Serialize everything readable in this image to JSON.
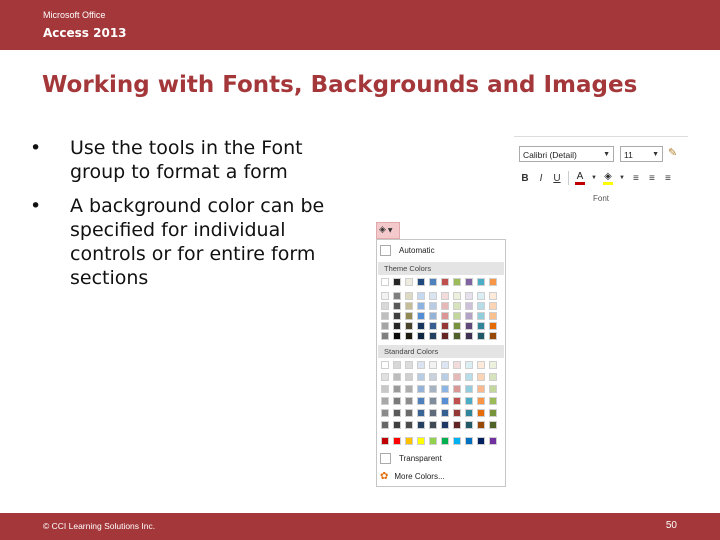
{
  "header": {
    "brand": "Microsoft Office",
    "product": "Access 2013"
  },
  "slide": {
    "title": "Working with Fonts, Backgrounds and Images",
    "bullets": [
      "Use the tools in the Font group to format a form",
      "A background color can be specified for individual controls or for entire form sections"
    ]
  },
  "font_group": {
    "font_name": "Calibri (Detail)",
    "font_size": "11",
    "group_label": "Font",
    "tools": [
      "B",
      "I",
      "U",
      "A",
      "A",
      "≡",
      "≡",
      "≡"
    ]
  },
  "color_picker": {
    "automatic_label": "Automatic",
    "theme_colors_label": "Theme Colors",
    "standard_colors_label": "Standard Colors",
    "transparent_label": "Transparent",
    "more_colors_label": "More Colors...",
    "theme_top": [
      "#ffffff",
      "#262626",
      "#eeece1",
      "#1f497d",
      "#4f81bd",
      "#c0504d",
      "#9bbb59",
      "#8064a2",
      "#4bacc6",
      "#f79646"
    ],
    "theme_shades": [
      [
        "#f2f2f2",
        "#7f7f7f",
        "#ddd9c3",
        "#c6d9f0",
        "#dbe5f1",
        "#f2dcdb",
        "#ebf1dd",
        "#e5e0ec",
        "#dbeef3",
        "#fdeada"
      ],
      [
        "#d8d8d8",
        "#595959",
        "#c4bd97",
        "#8db3e2",
        "#b8cce4",
        "#e5b9b7",
        "#d7e3bc",
        "#ccc1d9",
        "#b7dde8",
        "#fbd5b5"
      ],
      [
        "#bfbfbf",
        "#3f3f3f",
        "#938953",
        "#548dd4",
        "#95b3d7",
        "#d99694",
        "#c3d69b",
        "#b2a2c7",
        "#92cddc",
        "#fac08f"
      ],
      [
        "#a5a5a5",
        "#262626",
        "#494429",
        "#17365d",
        "#366092",
        "#953734",
        "#76923c",
        "#5f497a",
        "#31859b",
        "#e36c09"
      ],
      [
        "#7f7f7f",
        "#0c0c0c",
        "#1d1b10",
        "#0f243e",
        "#244061",
        "#632423",
        "#4f6128",
        "#3f3151",
        "#205867",
        "#974806"
      ]
    ],
    "standard_rows": [
      [
        "#ffffff",
        "#d8d8d8",
        "#dcdcdc",
        "#dbe5f1",
        "#f2f2f2",
        "#dce6f2",
        "#f2dcdb",
        "#dbeef3",
        "#fdeada",
        "#ebf1dd"
      ],
      [
        "#e0e0e0",
        "#bdbdbd",
        "#d0d0d0",
        "#b8cce4",
        "#c9d2dc",
        "#b9cde5",
        "#e6b9b8",
        "#b7dde8",
        "#fbd5b5",
        "#d7e3bc"
      ],
      [
        "#c8c8c8",
        "#9a9a9a",
        "#aeaeae",
        "#95b3d7",
        "#a6b3c2",
        "#8eb4e3",
        "#d99795",
        "#93cddd",
        "#f9b98c",
        "#c3d69b"
      ],
      [
        "#a8a8a8",
        "#7a7a7a",
        "#8c8c8c",
        "#4f81bd",
        "#7f8c9b",
        "#558ed5",
        "#c0504d",
        "#4bacc6",
        "#f79646",
        "#9bbb59"
      ],
      [
        "#8a8a8a",
        "#5a5a5a",
        "#6a6a6a",
        "#3a6396",
        "#5f6b7a",
        "#376092",
        "#953735",
        "#31859c",
        "#e46c0a",
        "#77933c"
      ],
      [
        "#666666",
        "#3f3f3f",
        "#4a4a4a",
        "#254061",
        "#404a55",
        "#1f3864",
        "#632523",
        "#215968",
        "#984807",
        "#4f6228"
      ],
      [
        "#c00000",
        "#ff0000",
        "#ffc000",
        "#ffff00",
        "#92d050",
        "#00b050",
        "#00b0f0",
        "#0070c0",
        "#002060",
        "#7030a0"
      ]
    ]
  },
  "footer": {
    "copyright": "© CCI Learning Solutions Inc.",
    "page_number": "50"
  }
}
